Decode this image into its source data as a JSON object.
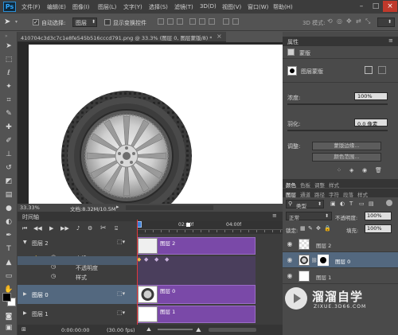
{
  "app": {
    "logo": "Ps"
  },
  "menu": [
    "文件(F)",
    "编辑(E)",
    "图像(I)",
    "图层(L)",
    "文字(Y)",
    "选择(S)",
    "滤镜(T)",
    "3D(D)",
    "视图(V)",
    "窗口(W)",
    "帮助(H)"
  ],
  "window_controls": {
    "minimize": "–",
    "maximize": "□",
    "close": "×"
  },
  "options": {
    "auto_select_label": "自动选择:",
    "auto_select_value": "图层",
    "show_transform_label": "显示变换控件",
    "mode_3d_label": "3D 模式:"
  },
  "document": {
    "tab_title": "410704c3d3c7c1e8fe545b516cccd791.png @ 33.3% (图层 0, 图层蒙版/8) *",
    "zoom": "33.33%",
    "doc_info": "文档:8.32M/10.5M"
  },
  "timeline": {
    "title": "时间轴",
    "time_marks": [
      "02:00f",
      "04:00f"
    ],
    "current_time": "0:00:00:00",
    "fps": "(30.00 fps)",
    "layers": [
      {
        "name": "图层 2",
        "clip": "图层 2"
      },
      {
        "name": "图层 0",
        "clip": "图层 0"
      },
      {
        "name": "图层 1",
        "clip": "图层 1"
      }
    ],
    "properties": [
      "变换",
      "不透明度",
      "样式"
    ]
  },
  "properties_panel": {
    "title": "属性",
    "mask_label": "蒙版",
    "layer_mask_label": "图层蒙版",
    "density_label": "浓度:",
    "density_value": "100%",
    "feather_label": "羽化:",
    "feather_value": "0.0 像素",
    "adjust_label": "调整:",
    "mask_edge_button": "蒙版边缘...",
    "color_range_button": "颜色范围..."
  },
  "layers_panel": {
    "tabs_row1": [
      "颜色",
      "色板",
      "调整",
      "样式"
    ],
    "tabs_row2": [
      "图层",
      "通道",
      "路径",
      "字符",
      "段落",
      "样式"
    ],
    "filter_kind": "类型",
    "blend_mode": "正常",
    "opacity_label": "不透明度:",
    "opacity_value": "100%",
    "lock_label": "锁定:",
    "fill_label": "填充:",
    "fill_value": "100%",
    "layers": [
      {
        "name": "图层 2"
      },
      {
        "name": "图层 0",
        "selected": true
      },
      {
        "name": "图层 1"
      }
    ]
  },
  "watermark": {
    "brand": "溜溜自学",
    "url": "ZIXUE.3D66.COM"
  },
  "colors": {
    "accent_purple": "#7a49a8",
    "playhead": "#e0383b",
    "selection": "#53687f",
    "ps_blue": "#31a8ff"
  }
}
